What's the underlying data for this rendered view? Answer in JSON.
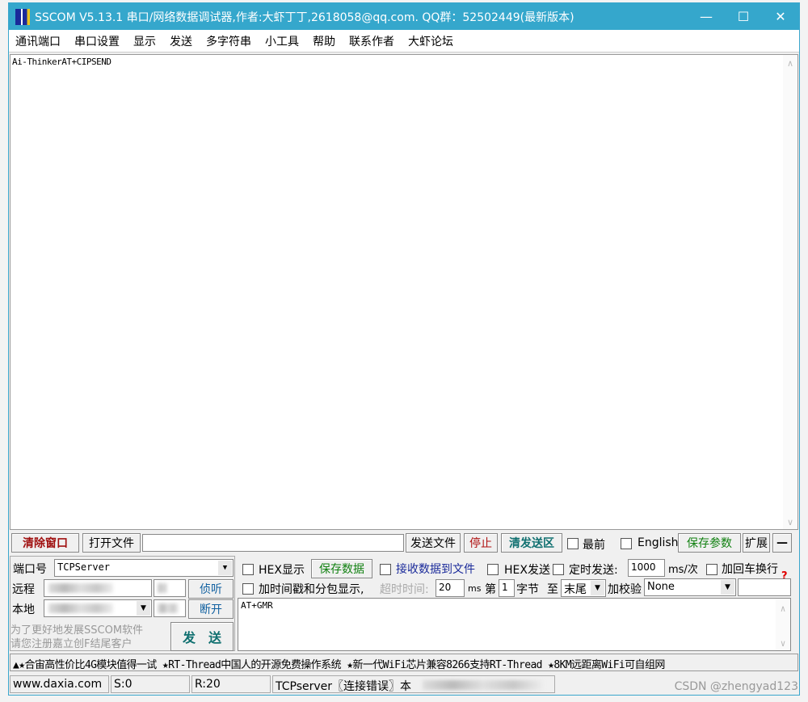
{
  "window": {
    "title": "SSCOM V5.13.1 串口/网络数据调试器,作者:大虾丁丁,2618058@qq.com. QQ群：52502449(最新版本)",
    "minimize": "—",
    "maximize": "☐",
    "close": "✕"
  },
  "menu": [
    "通讯端口",
    "串口设置",
    "显示",
    "发送",
    "多字符串",
    "小工具",
    "帮助",
    "联系作者",
    "大虾论坛"
  ],
  "receive": {
    "text": "Ai-ThinkerAT+CIPSEND"
  },
  "toolbar": {
    "clear": "清除窗口",
    "open_file": "打开文件",
    "file_path": "",
    "send_file": "发送文件",
    "stop": "停止",
    "clear_send": "清发送区",
    "topmost": "最前",
    "english": "English",
    "save_params": "保存参数",
    "expand": "扩展",
    "collapse": "—"
  },
  "conn": {
    "port_label": "端口号",
    "port_value": "TCPServer",
    "remote_label": "远程",
    "local_label": "本地",
    "listen": "侦听",
    "disconnect": "断开",
    "promo": "为了更好地发展SSCOM软件\n请您注册嘉立创F结尾客户",
    "send": "发　送"
  },
  "options": {
    "hex_display": "HEX显示",
    "save_data": "保存数据",
    "recv_to_file": "接收数据到文件",
    "hex_send": "HEX发送",
    "timed_send": "定时发送:",
    "interval": "1000",
    "interval_unit": "ms/次",
    "add_crlf": "加回车换行",
    "timestamp": "加时间戳和分包显示,",
    "timeout_label": "超时时间:",
    "timeout": "20",
    "ms": "ms",
    "byte_from_label": "第",
    "byte_from": "1",
    "byte_label": "字节",
    "to_label": "至",
    "byte_to": "末尾",
    "checksum_label": "加校验",
    "checksum": "None",
    "help": "?"
  },
  "send_text": "AT+GMR",
  "ticker": "▲★合宙高性价比4G模块值得一试 ★RT-Thread中国人的开源免费操作系统 ★新一代WiFi芯片兼容8266支持RT-Thread ★8KM远距离WiFi可自组网",
  "status": {
    "site": "www.daxia.com",
    "sent": "S:0",
    "received": "R:20",
    "conn": "TCPserver〖连接错误〗本",
    "watermark": "CSDN @zhengyad123"
  }
}
